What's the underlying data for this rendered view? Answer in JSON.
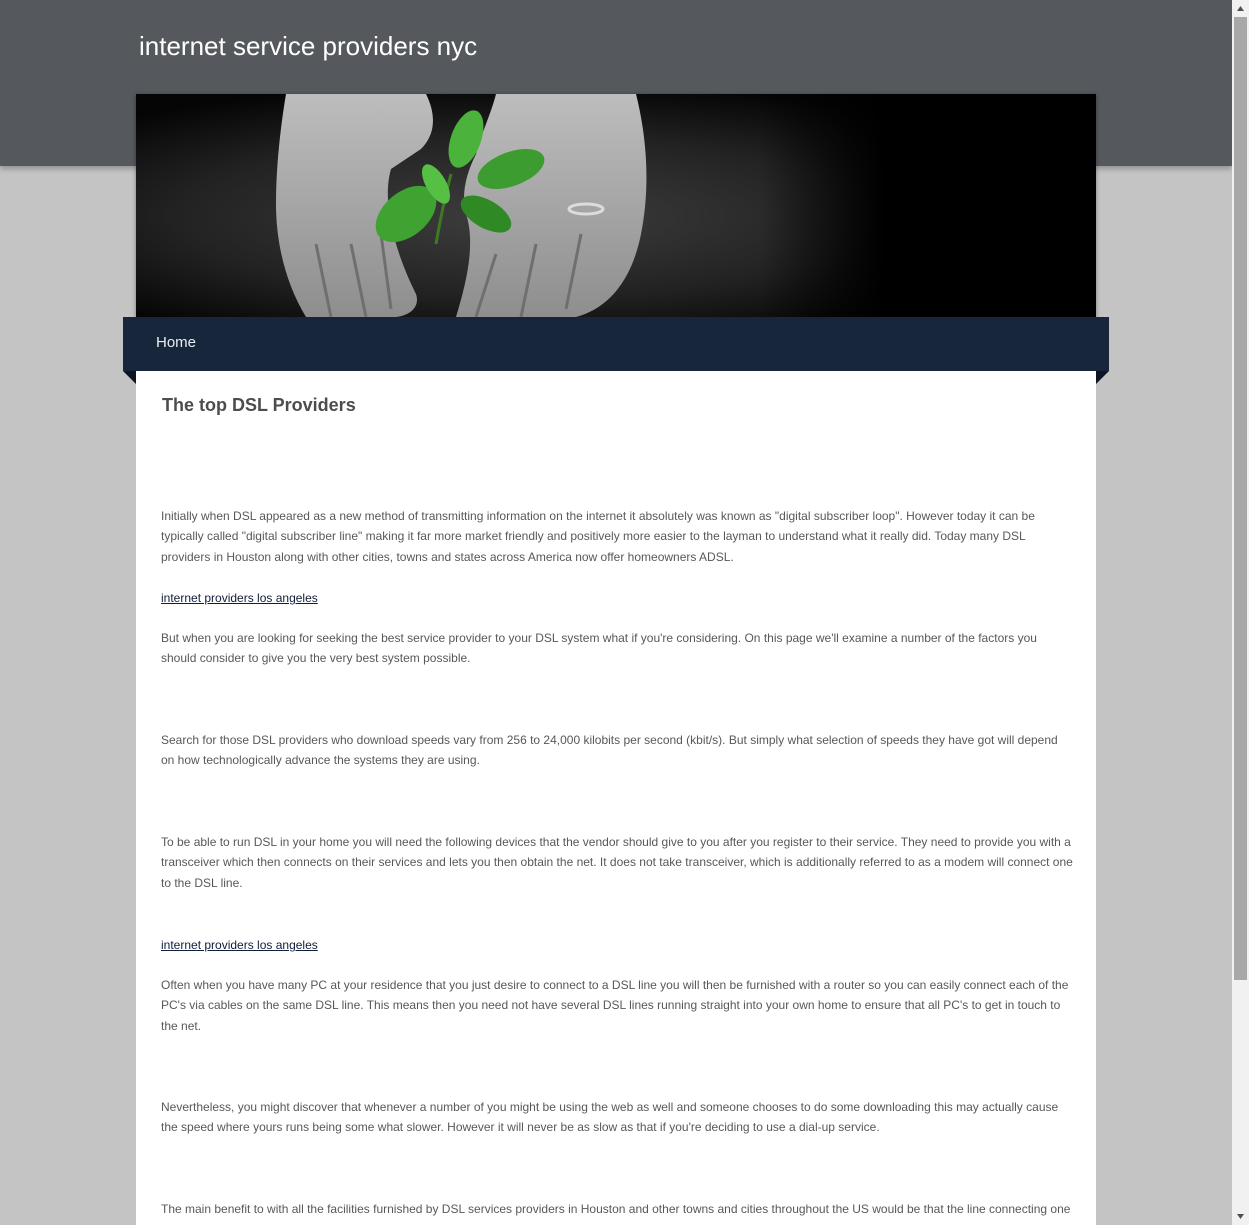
{
  "header": {
    "site_title": "internet service providers nyc"
  },
  "nav": {
    "home_label": "Home"
  },
  "article": {
    "title": "The top DSL Providers",
    "paragraphs": [
      "Initially when DSL appeared as a new method of transmitting information on the internet it absolutely was known as \"digital subscriber loop\". However today it can be typically called \"digital subscriber line\" making it far more market friendly and positively more easier to the layman to understand what it really did. Today many DSL providers in Houston along with other cities, towns and states across America now offer homeowners ADSL.",
      "But when you are looking for seeking the best service provider to your DSL system what if you're considering. On this page we'll examine a number of the factors you should consider to give you the very best system possible.",
      "Search for those DSL providers who download speeds vary from 256 to 24,000 kilobits per second (kbit/s). But simply what selection of speeds they have got will depend on how technologically advance the systems they are using.",
      "To be able to run DSL in your home you will need the following devices that the vendor should give to you after you register to their service. They need to provide you with a transceiver which then connects on their services and lets you then obtain the net. It does not take transceiver, which is additionally referred to as a modem will connect one to the DSL line.",
      "Often when you have many PC at your residence that you just desire to connect to a DSL line you will then be furnished with a router so you can easily connect each of the PC's via cables on the same DSL line. This means then you need not have several DSL lines running straight into your own home to ensure that all PC's to get in touch to the net.",
      "Nevertheless, you might discover that whenever a number of you might be using the web as well and someone chooses to do some downloading this may actually cause the speed where yours runs being some what slower. However it will never be as slow as that if you're deciding to use a dial-up service.",
      "The main benefit to with all the facilities furnished by DSL services providers in Houston and other towns and cities throughout the US would be that the line connecting one"
    ],
    "links": [
      "internet providers los angeles",
      "internet providers los angeles"
    ]
  },
  "colors": {
    "header_bg": "#55585d",
    "nav_bg": "#17263a",
    "page_bg": "#c4c4c4",
    "link": "#101e3a"
  },
  "icons": {
    "banner": "hands-with-plant-image",
    "scroll_up": "arrow-up-icon",
    "scroll_down": "arrow-down-icon"
  }
}
